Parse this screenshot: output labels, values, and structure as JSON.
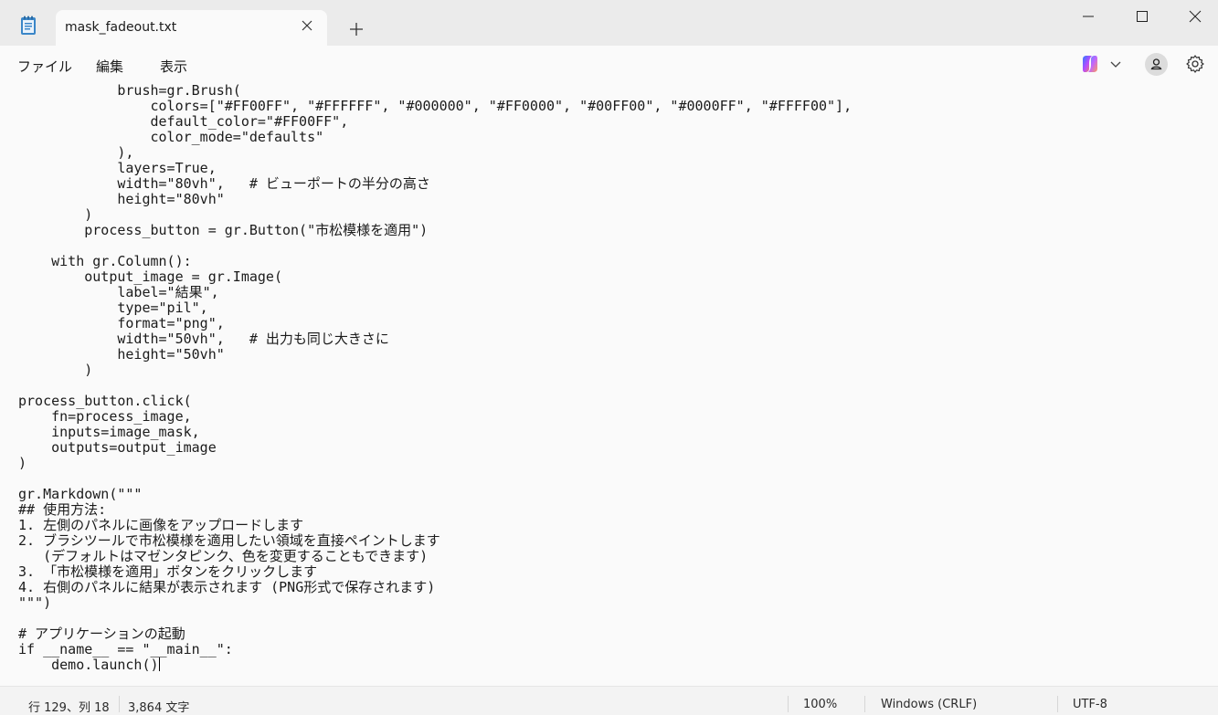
{
  "tab": {
    "title": "mask_fadeout.txt"
  },
  "menu": {
    "file": "ファイル",
    "edit": "編集",
    "view": "表示"
  },
  "editor": {
    "lines": [
      "            brush=gr.Brush(",
      "                colors=[\"#FF00FF\", \"#FFFFFF\", \"#000000\", \"#FF0000\", \"#00FF00\", \"#0000FF\", \"#FFFF00\"],",
      "                default_color=\"#FF00FF\",",
      "                color_mode=\"defaults\"",
      "            ),",
      "            layers=True,",
      "            width=\"80vh\",   # ビューポートの半分の高さ",
      "            height=\"80vh\"",
      "        )",
      "        process_button = gr.Button(\"市松模様を適用\")",
      "",
      "    with gr.Column():",
      "        output_image = gr.Image(",
      "            label=\"結果\",",
      "            type=\"pil\",",
      "            format=\"png\",",
      "            width=\"50vh\",   # 出力も同じ大きさに",
      "            height=\"50vh\"",
      "        )",
      "",
      "process_button.click(",
      "    fn=process_image,",
      "    inputs=image_mask,",
      "    outputs=output_image",
      ")",
      "",
      "gr.Markdown(\"\"\"",
      "## 使用方法:",
      "1. 左側のパネルに画像をアップロードします",
      "2. ブラシツールで市松模様を適用したい領域を直接ペイントします",
      "   (デフォルトはマゼンタピンク、色を変更することもできます)",
      "3. 「市松模様を適用」ボタンをクリックします",
      "4. 右側のパネルに結果が表示されます (PNG形式で保存されます)",
      "\"\"\")",
      "",
      "# アプリケーションの起動",
      "if __name__ == \"__main__\":",
      "    demo.launch()"
    ]
  },
  "status": {
    "position": "行 129、列 18",
    "chars": "3,864 文字",
    "zoom": "100%",
    "line_ending": "Windows (CRLF)",
    "encoding": "UTF-8"
  },
  "colors": {
    "titlebar": "#ebebeb",
    "editor_bg": "#fafafa",
    "text": "#1b1b1b"
  }
}
